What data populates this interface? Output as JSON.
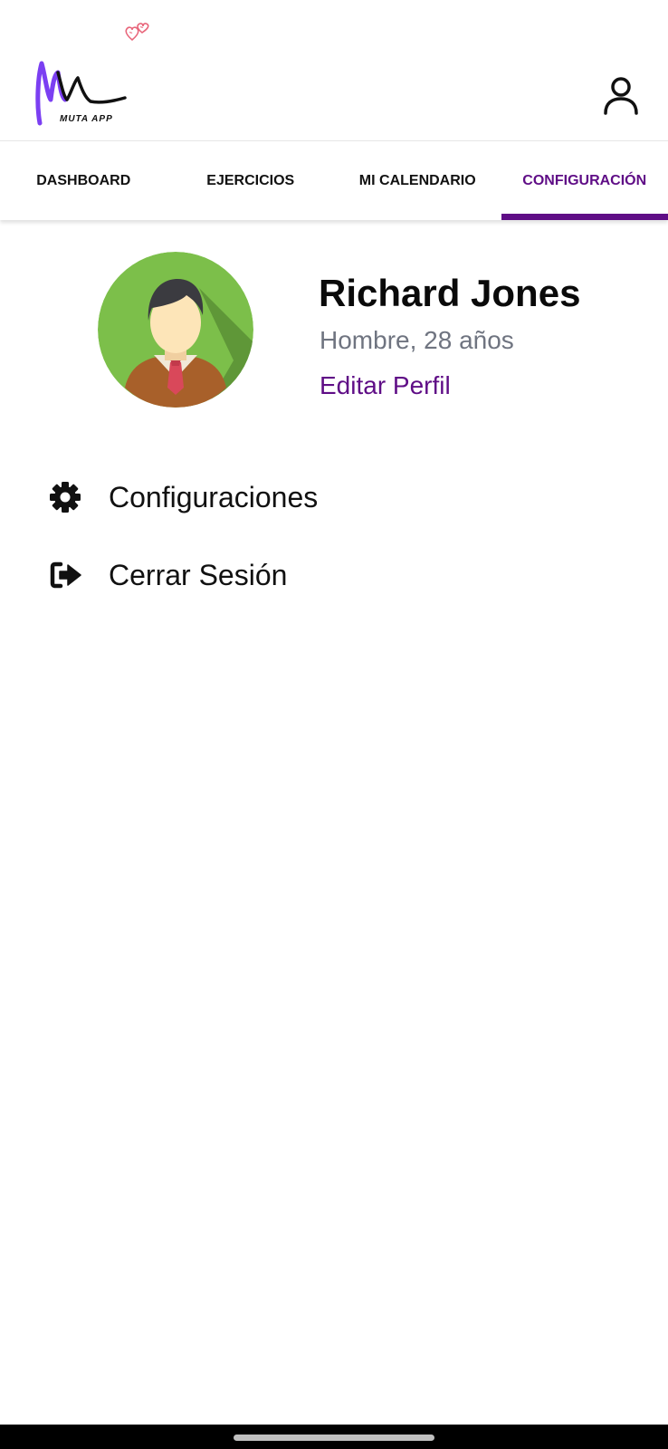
{
  "app": {
    "logo_text": "MUTA APP",
    "brand_color": "#5f0d86",
    "logo_accent_color": "#7b3ff2",
    "hearts_color": "#e8657a",
    "logo_icon": "muta-app-logo",
    "user_icon": "user-account-icon"
  },
  "tabs": [
    {
      "label": "DASHBOARD",
      "active": false
    },
    {
      "label": "EJERCICIOS",
      "active": false
    },
    {
      "label": "MI CALENDARIO",
      "active": false
    },
    {
      "label": "CONFIGURACIÓN",
      "active": true
    }
  ],
  "profile": {
    "name": "Richard Jones",
    "info": "Hombre, 28 años",
    "edit_label": "Editar Perfil",
    "avatar_icon": "male-avatar-icon",
    "avatar_bg_color": "#7cbf4a"
  },
  "menu": [
    {
      "label": "Configuraciones",
      "icon": "gear-icon"
    },
    {
      "label": "Cerrar Sesión",
      "icon": "sign-out-icon"
    }
  ]
}
